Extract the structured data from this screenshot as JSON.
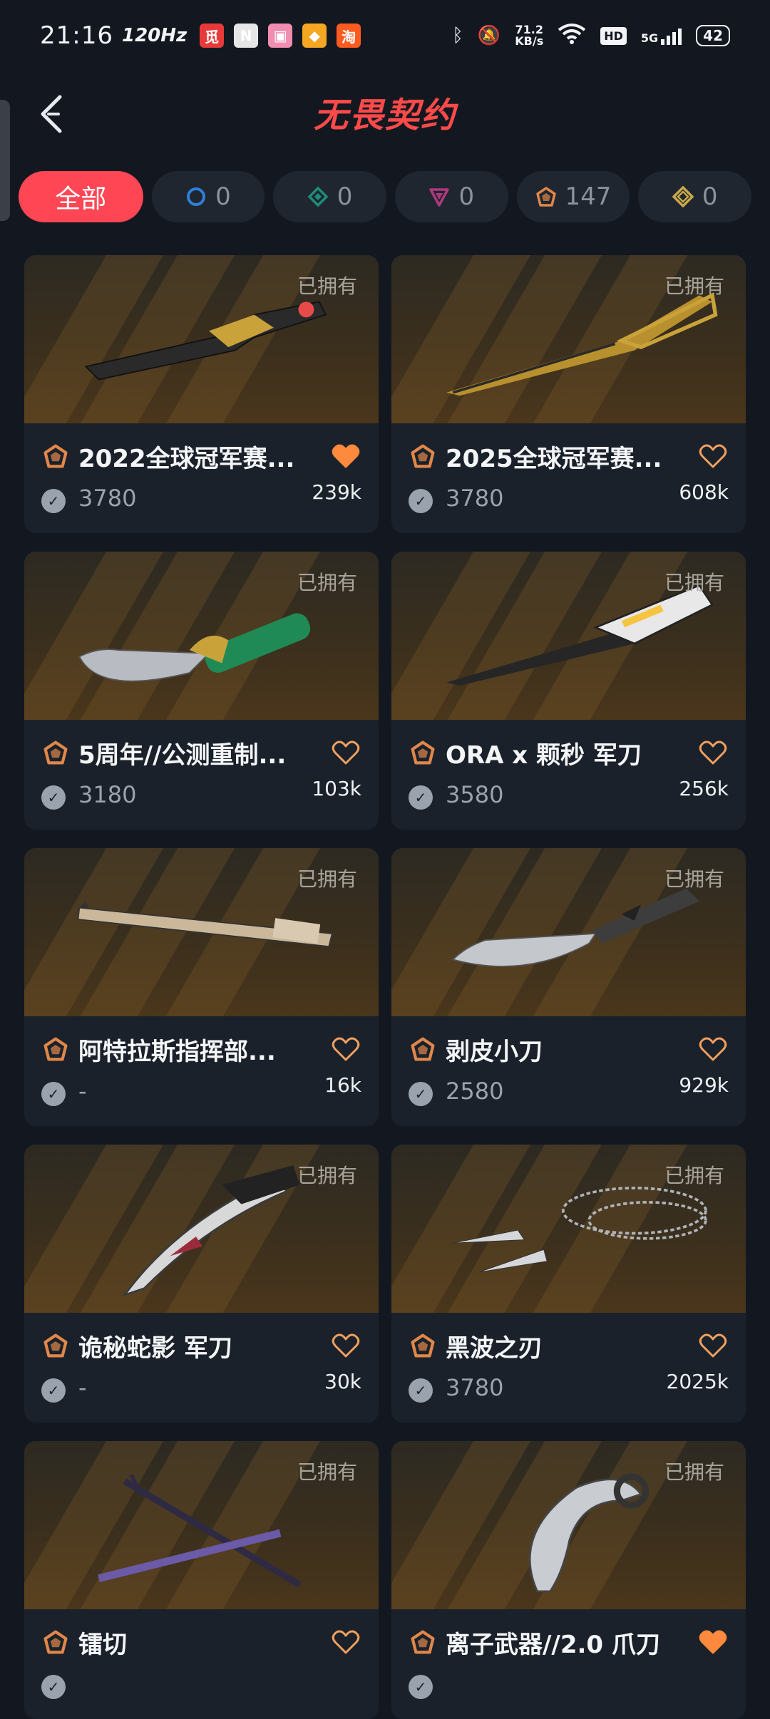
{
  "status_bar": {
    "time": "21:16",
    "refresh_rate": "120Hz",
    "net_speed_value": "71.2",
    "net_speed_unit": "KB/s",
    "hd_label": "HD",
    "network_label": "5G",
    "battery": "42",
    "app_icons": [
      {
        "name": "app-icon-1",
        "glyph": "觅",
        "color": "#e83a3a"
      },
      {
        "name": "app-icon-2",
        "glyph": "N",
        "color": "#e6e6e6"
      },
      {
        "name": "app-icon-3",
        "glyph": "▣",
        "color": "#f08db0"
      },
      {
        "name": "app-icon-4",
        "glyph": "◆",
        "color": "#f5a623"
      },
      {
        "name": "app-icon-5",
        "glyph": "淘",
        "color": "#ff5a1f"
      }
    ]
  },
  "header": {
    "title": "无畏契约",
    "back_icon": "chevron-left-icon"
  },
  "filters": [
    {
      "label": "全部",
      "active": true
    },
    {
      "count": "0",
      "icon": "tier-select-icon",
      "color": "#2f7fd6"
    },
    {
      "count": "0",
      "icon": "tier-deluxe-icon",
      "color": "#1d8c7a"
    },
    {
      "count": "0",
      "icon": "tier-premium-icon",
      "color": "#b0387f"
    },
    {
      "count": "147",
      "icon": "tier-exclusive-icon",
      "color": "#e0874a"
    },
    {
      "count": "0",
      "icon": "tier-ultra-icon",
      "color": "#c9a84a"
    }
  ],
  "owned_label": "已拥有",
  "colors": {
    "accent": "#ff4654",
    "exclusive_tier": "#e0874a",
    "heart_filled": "#ff8a3d",
    "heart_outline": "#f0a060"
  },
  "items": [
    {
      "name": "2022全球冠军赛...",
      "price": "3780",
      "likes": "239k",
      "favorited": true,
      "owned": true
    },
    {
      "name": "2025全球冠军赛...",
      "price": "3780",
      "likes": "608k",
      "favorited": false,
      "owned": true
    },
    {
      "name": "5周年//公测重制...",
      "price": "3180",
      "likes": "103k",
      "favorited": false,
      "owned": true
    },
    {
      "name": "ORA x 颗秒 军刀",
      "price": "3580",
      "likes": "256k",
      "favorited": false,
      "owned": true
    },
    {
      "name": "阿特拉斯指挥部...",
      "price": "-",
      "likes": "16k",
      "favorited": false,
      "owned": true
    },
    {
      "name": "剥皮小刀",
      "price": "2580",
      "likes": "929k",
      "favorited": false,
      "owned": true
    },
    {
      "name": "诡秘蛇影 军刀",
      "price": "-",
      "likes": "30k",
      "favorited": false,
      "owned": true
    },
    {
      "name": "黑波之刃",
      "price": "3780",
      "likes": "2025k",
      "favorited": false,
      "owned": true
    },
    {
      "name": "镭切",
      "price": "",
      "likes": "",
      "favorited": false,
      "owned": true
    },
    {
      "name": "离子武器//2.0 爪刀",
      "price": "",
      "likes": "",
      "favorited": true,
      "owned": true
    }
  ]
}
